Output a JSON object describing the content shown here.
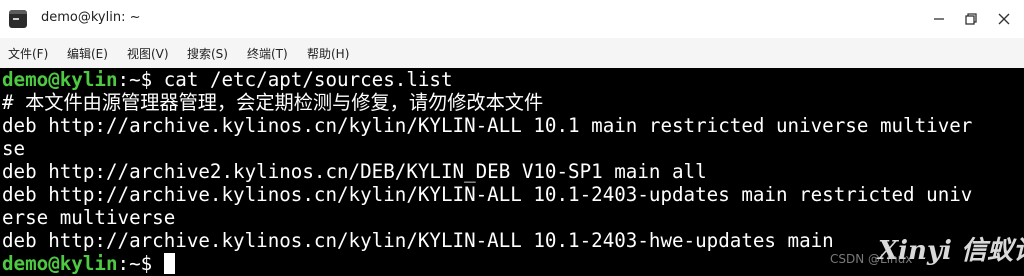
{
  "window": {
    "title": "demo@kylin: ~",
    "app_icon": "terminal-icon",
    "controls": {
      "minimize_icon": "minimize-icon",
      "maximize_icon": "restore-icon",
      "close_icon": "close-icon"
    }
  },
  "menu": {
    "items": [
      "文件(F)",
      "编辑(E)",
      "视图(V)",
      "搜索(S)",
      "终端(T)",
      "帮助(H)"
    ]
  },
  "terminal": {
    "prompt_user": "demo@kylin",
    "prompt_path": ":~$",
    "command": " cat /etc/apt/sources.list",
    "output": [
      "# 本文件由源管理器管理，会定期检测与修复，请勿修改本文件",
      "deb http://archive.kylinos.cn/kylin/KYLIN-ALL 10.1 main restricted universe multiver",
      "se",
      "deb http://archive2.kylinos.cn/DEB/KYLIN_DEB V10-SP1 main all",
      "deb http://archive.kylinos.cn/kylin/KYLIN-ALL 10.1-2403-updates main restricted univ",
      "erse multiverse",
      "deb http://archive.kylinos.cn/kylin/KYLIN-ALL 10.1-2403-hwe-updates main"
    ],
    "final_prompt_user": "demo@kylin",
    "final_prompt_path": ":~$",
    "colors": {
      "background": "#000000",
      "text": "#ffffff",
      "prompt": "#4ec942"
    }
  },
  "watermark": {
    "text": "Xinyi 信蚁论坛",
    "small_text": "CSDN @Linux"
  }
}
